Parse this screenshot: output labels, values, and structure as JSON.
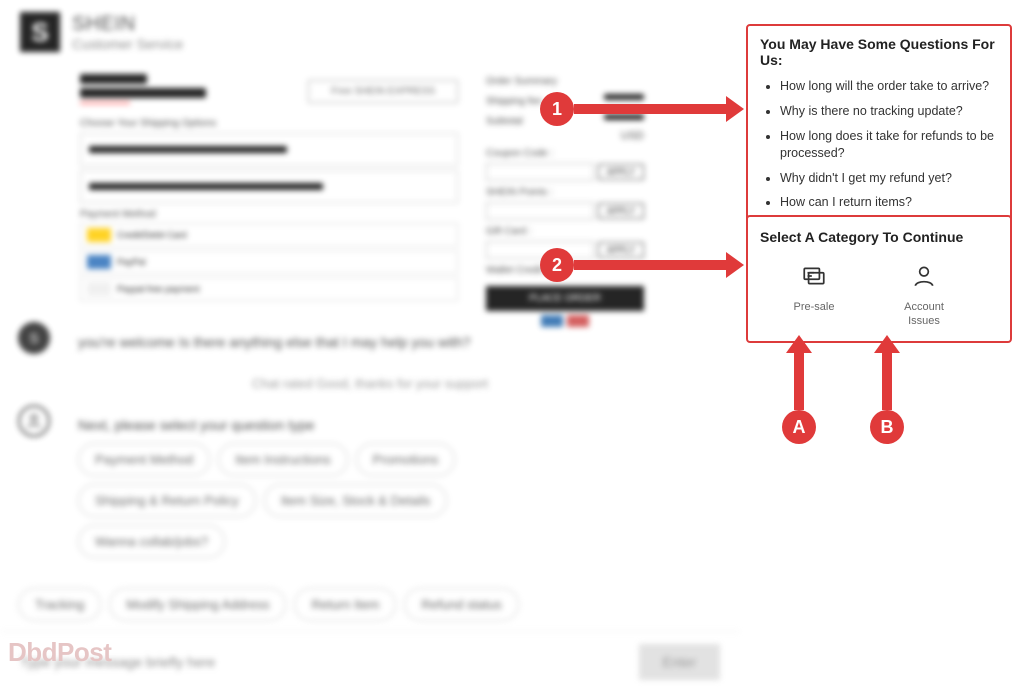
{
  "header": {
    "logo_letter": "S",
    "brand": "SHEIN",
    "subtitle": "Customer Service"
  },
  "checkout": {
    "free_ship_btn": "Free SHEIN EXPRESS",
    "ship_heading": "Choose Your Shipping Options",
    "pay_heading": "Payment Method",
    "pay_items": [
      "Credit/Debit Card",
      "PayPal",
      "Paypal free payment"
    ],
    "right": {
      "order_summary": "Order Summary",
      "shipping": "Shipping fee",
      "subtotal": "Subtotal",
      "usd": "USD",
      "coupon_label": "Coupon Code :",
      "points_label": "SHEIN Points :",
      "gift_label": "Gift Card :",
      "wallet_label": "Wallet Credit :",
      "apply": "APPLY",
      "place_order": "PLACE ORDER"
    }
  },
  "chat": {
    "agent_msg": "you're welcome Is there anything else that I may help you with?",
    "rating_msg": "Chat rated Good, thanks for your support",
    "bot_msg": "Next, please select your question type",
    "chips_group1": [
      "Payment Method",
      "Item Instructions",
      "Promotions",
      "Shipping & Return Policy",
      "Item Size, Stock & Details",
      "Wanna collab/jobs?"
    ],
    "bottom_chips": [
      "Tracking",
      "Modify Shipping Address",
      "Return Item",
      "Refund status"
    ],
    "placeholder": "Type your message briefly here",
    "enter": "Enter"
  },
  "faq": {
    "title": "You May Have Some Questions For Us:",
    "items": [
      "How long will the order take to arrive?",
      "Why is there no tracking update?",
      "How long does it take for refunds to be processed?",
      "Why didn't I get my refund yet?",
      "How can I return items?"
    ]
  },
  "categories": {
    "title": "Select A Category To Continue",
    "items": [
      {
        "label": "Pre-sale"
      },
      {
        "label": "Account Issues"
      }
    ]
  },
  "annotations": {
    "one": "1",
    "two": "2",
    "a": "A",
    "b": "B"
  },
  "watermark": "DbdPost"
}
